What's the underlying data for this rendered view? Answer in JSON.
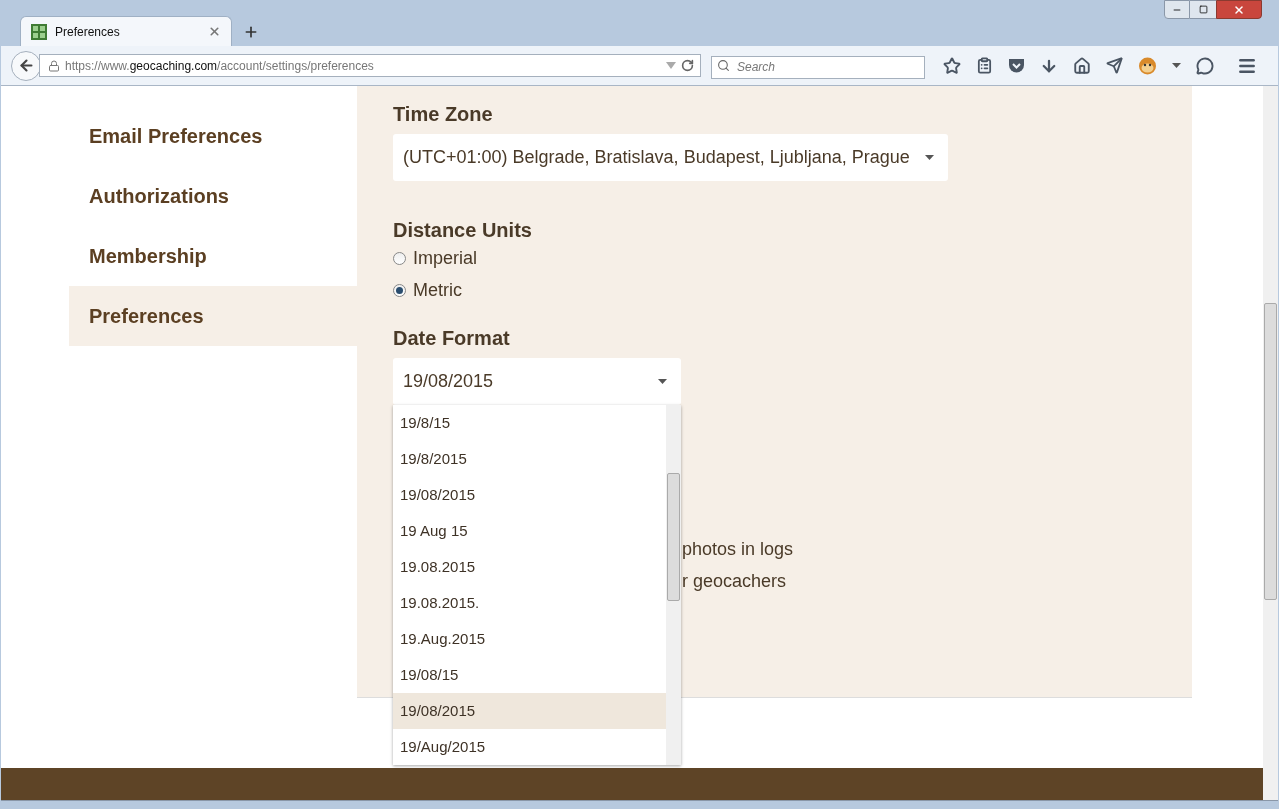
{
  "browser": {
    "tab": {
      "title": "Preferences"
    },
    "url": {
      "prefix": "https://www.",
      "host": "geocaching.com",
      "path": "/account/settings/preferences"
    },
    "search": {
      "placeholder": "Search"
    }
  },
  "sidebar": {
    "items": [
      {
        "label": "Email Preferences",
        "selected": false
      },
      {
        "label": "Authorizations",
        "selected": false
      },
      {
        "label": "Membership",
        "selected": false
      },
      {
        "label": "Preferences",
        "selected": true
      }
    ]
  },
  "time_zone": {
    "label": "Time Zone",
    "value": "(UTC+01:00) Belgrade, Bratislava, Budapest, Ljubljana, Prague"
  },
  "distance_units": {
    "label": "Distance Units",
    "options": [
      {
        "label": "Imperial",
        "selected": false
      },
      {
        "label": "Metric",
        "selected": true
      }
    ]
  },
  "date_format": {
    "label": "Date Format",
    "value": "19/08/2015",
    "open": true,
    "options": [
      {
        "label": "19/8/15",
        "highlighted": false
      },
      {
        "label": "19/8/2015",
        "highlighted": false
      },
      {
        "label": "19/08/2015",
        "highlighted": false
      },
      {
        "label": "19 Aug 15",
        "highlighted": false
      },
      {
        "label": "19.08.2015",
        "highlighted": false
      },
      {
        "label": "19.08.2015.",
        "highlighted": false
      },
      {
        "label": "19.Aug.2015",
        "highlighted": false
      },
      {
        "label": "19/08/15",
        "highlighted": false
      },
      {
        "label": "19/08/2015",
        "highlighted": true
      },
      {
        "label": "19/Aug/2015",
        "highlighted": false
      }
    ]
  },
  "partly_hidden_lines": [
    "photos in logs",
    "r geocachers"
  ]
}
